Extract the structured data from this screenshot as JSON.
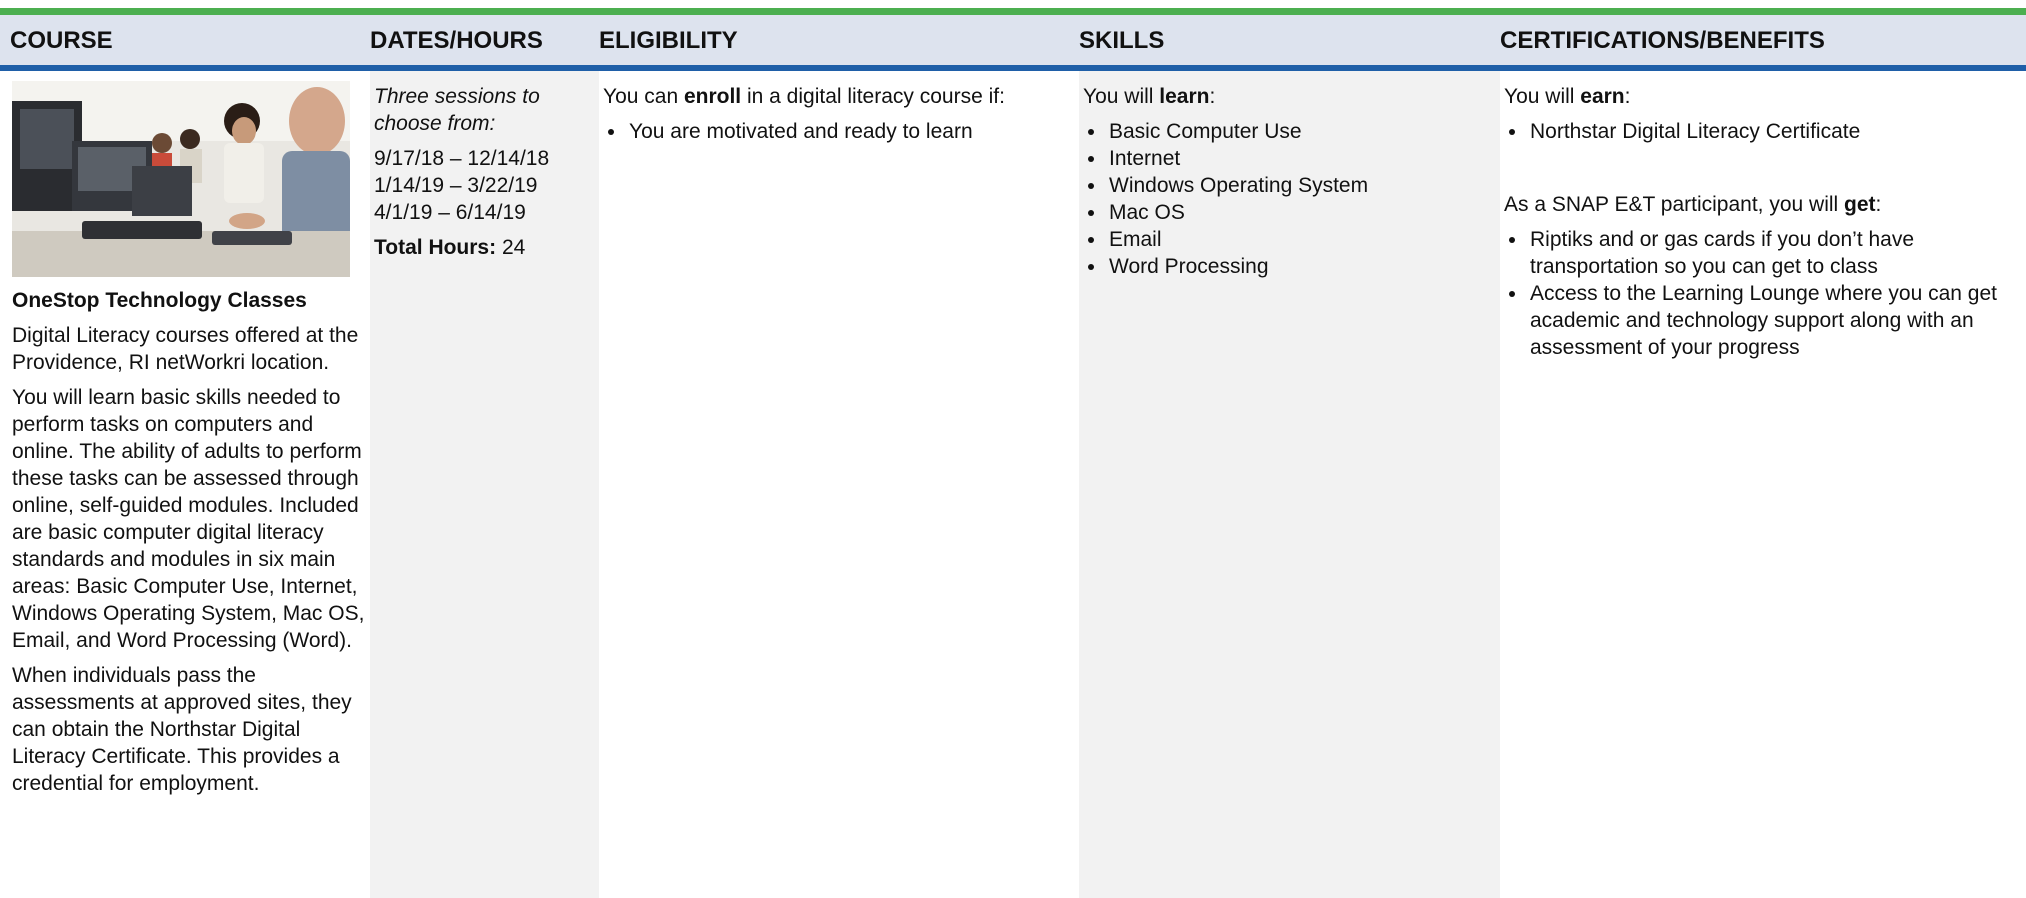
{
  "headers": {
    "course": "COURSE",
    "dates": "DATES/HOURS",
    "eligibility": "ELIGIBILITY",
    "skills": "SKILLS",
    "certifications": "CERTIFICATIONS/BENEFITS"
  },
  "course": {
    "image_alt": "Adults working at computers in a classroom",
    "title": "OneStop Technology Classes",
    "para1": "Digital Literacy courses offered at the Providence, RI netWorkri location.",
    "para2": "You will learn basic skills needed to perform tasks on computers and online. The ability of adults to perform these tasks can be assessed through online, self-guided modules. Included are basic computer digital literacy standards and modules in six main areas: Basic Computer Use, Internet, Windows Operating System, Mac OS, Email, and Word Processing (Word).",
    "para3": "When individuals pass the assessments at approved sites, they can obtain the Northstar Digital Literacy Certificate. This provides a credential for employment."
  },
  "dates": {
    "intro": "Three sessions to choose from:",
    "sessions": [
      "9/17/18 – 12/14/18",
      "1/14/19 – 3/22/19",
      "4/1/19 – 6/14/19"
    ],
    "total_label": "Total Hours:",
    "total_value": "24"
  },
  "eligibility": {
    "intro_pre": "You can ",
    "intro_bold": "enroll",
    "intro_post": " in a digital literacy course if:",
    "items": [
      "You are motivated and ready to learn"
    ]
  },
  "skills": {
    "intro_pre": "You will ",
    "intro_bold": "learn",
    "intro_post": ":",
    "items": [
      "Basic Computer Use",
      "Internet",
      "Windows Operating System",
      "Mac OS",
      "Email",
      "Word Processing"
    ]
  },
  "certifications": {
    "intro_pre": "You will ",
    "intro_bold": "earn",
    "intro_post": ":",
    "items": [
      "Northstar Digital Literacy Certificate"
    ],
    "snap_pre": "As a SNAP E&T participant, you will ",
    "snap_bold": "get",
    "snap_post": ":",
    "snap_items": [
      "Riptiks and or gas cards if you don’t have transportation so you can get to class",
      "Access to the Learning Lounge where you can get academic and technology support along with an assessment of your progress"
    ]
  },
  "colors": {
    "top_bar": "#4caf50",
    "header_bg": "#dde3ee",
    "header_rule": "#1f5fa8",
    "shaded_column": "#f2f2f2"
  }
}
